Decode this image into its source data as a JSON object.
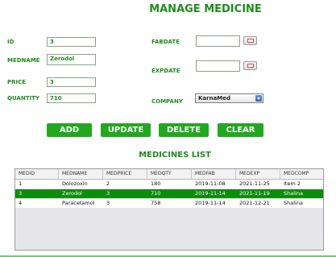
{
  "title": "MANAGE MEDICINE",
  "form": {
    "id_label": "ID",
    "id_value": "3",
    "medname_label": "MEDNAME",
    "medname_value": "Zerodol",
    "price_label": "PRICE",
    "price_value": "3",
    "quantity_label": "QUANTITY",
    "quantity_value": "710",
    "fabdate_label": "FABDATE",
    "fabdate_value": "",
    "expdate_label": "EXPDATE",
    "expdate_value": "",
    "company_label": "COMPANY",
    "company_value": "KarnaMed"
  },
  "buttons": {
    "add": "ADD",
    "update": "UPDATE",
    "delete": "DELETE",
    "clear": "CLEAR"
  },
  "list_title": "MEDICINES LIST",
  "table": {
    "columns": [
      "MEDID",
      "MEDNAME",
      "MEDPRICE",
      "MEDQTY",
      "MEDFAB",
      "MEDEXP",
      "MEDCOMP"
    ],
    "rows": [
      [
        "1",
        "Dolozoxin",
        "2",
        "180",
        "2019-11-08",
        "2021-11-25",
        "Item 2"
      ],
      [
        "3",
        "Zerodol",
        "3",
        "710",
        "2019-11-14",
        "2021-11-19",
        "Shalina"
      ],
      [
        "4",
        "Paracetamol",
        "3",
        "758",
        "2019-11-14",
        "2021-12-21",
        "Shalina"
      ]
    ],
    "selected_row": 1
  },
  "colors": {
    "accent": "#1e8c1e",
    "button": "#22a81f",
    "selected_row": "#0c8d0c"
  },
  "icons": {
    "calendar": "calendar-icon",
    "dropdown": "chevron-down-icon"
  }
}
